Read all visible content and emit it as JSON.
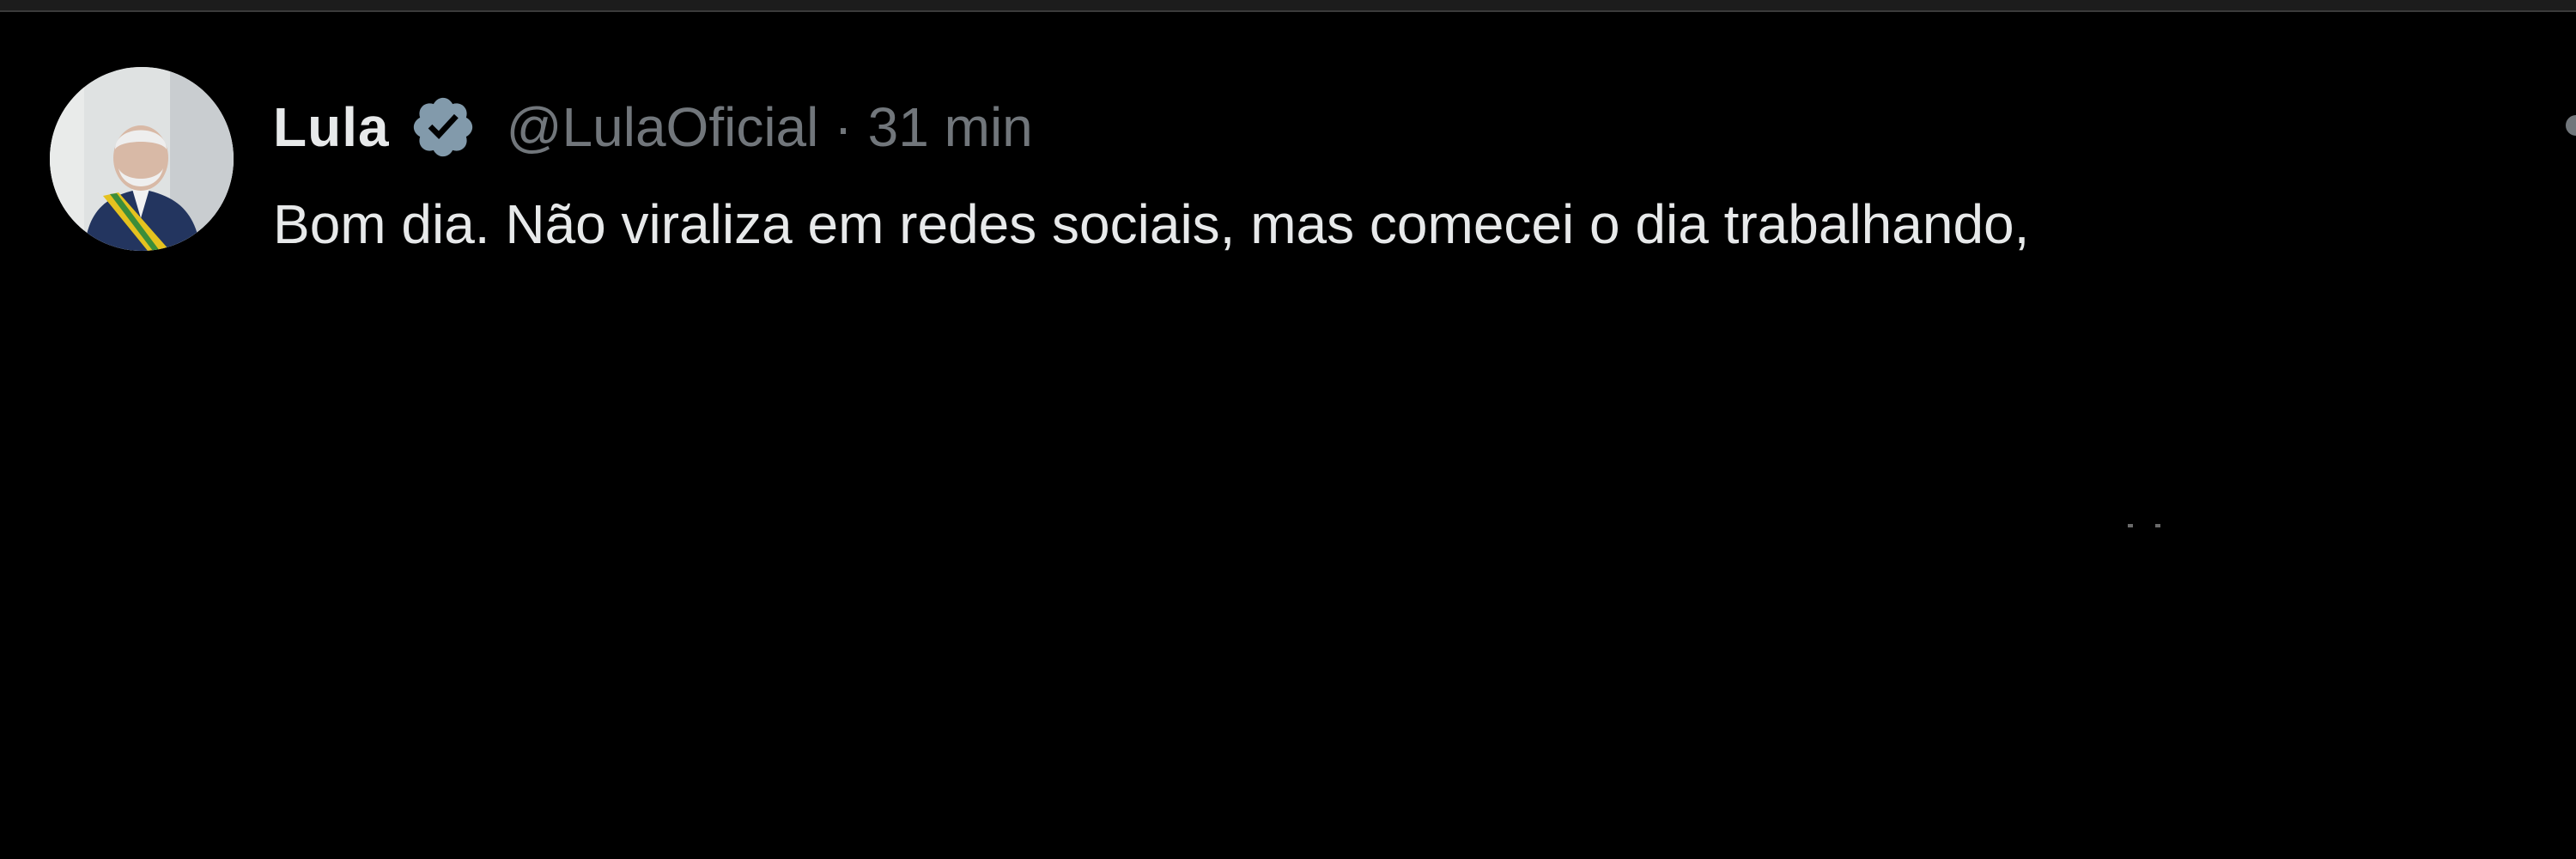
{
  "tweet": {
    "display_name": "Lula",
    "handle": "@LulaOficial",
    "separator": "·",
    "timestamp": "31 min",
    "text": "Bom dia. Não viraliza em redes sociais, mas comecei o dia trabalhando,",
    "verified_icon": "verified-badge-icon",
    "avatar_icon": "profile-avatar"
  },
  "colors": {
    "background": "#000000",
    "primary_text": "#e7e9ea",
    "secondary_text": "#71767b",
    "verified_badge": "#829aab"
  }
}
